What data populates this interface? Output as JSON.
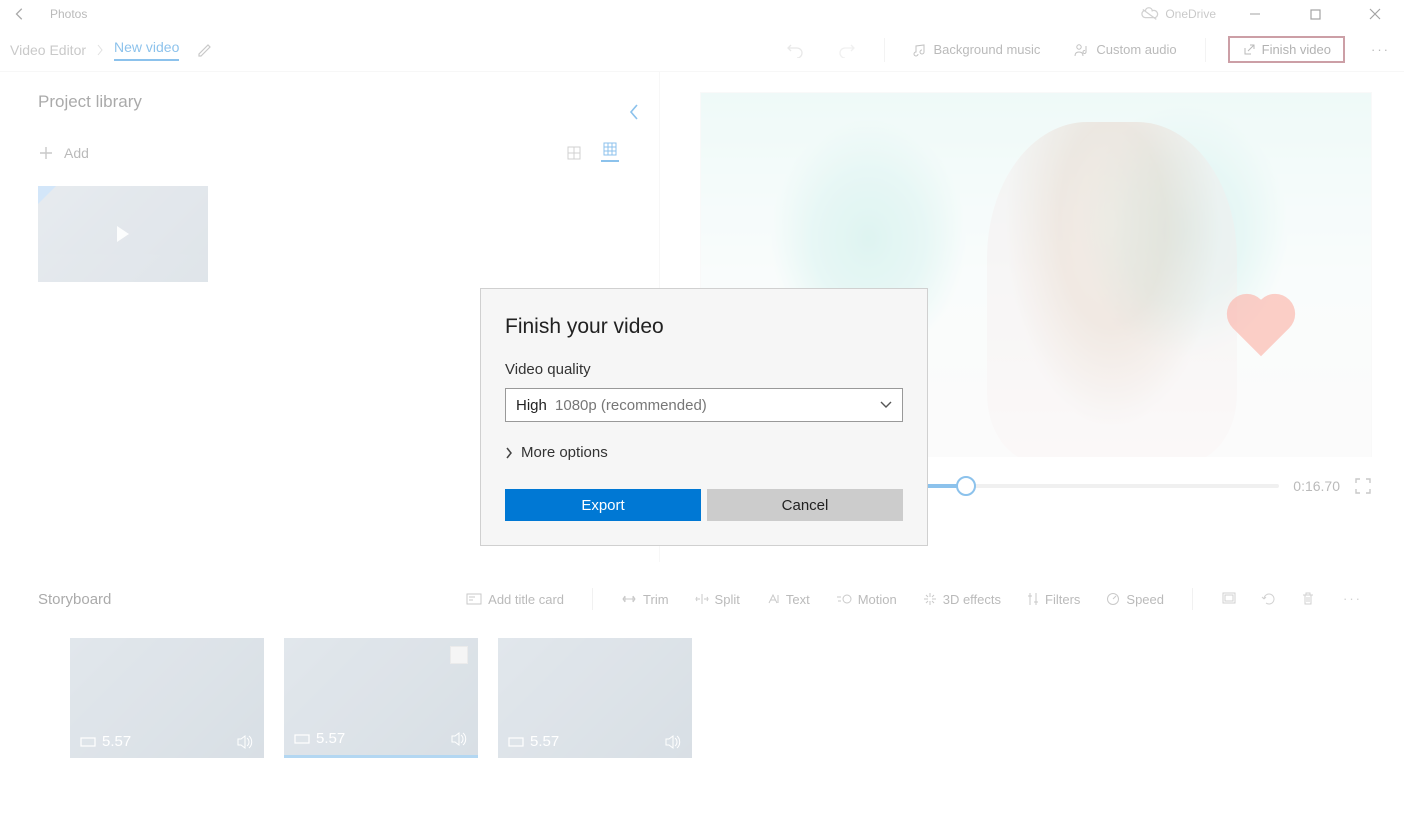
{
  "title_bar": {
    "app_name": "Photos",
    "onedrive": "OneDrive"
  },
  "breadcrumb": {
    "root": "Video Editor",
    "current": "New video"
  },
  "toolbar": {
    "bg_music": "Background music",
    "custom_audio": "Custom audio",
    "finish_video": "Finish video"
  },
  "library": {
    "title": "Project library",
    "add": "Add"
  },
  "preview": {
    "time": "0:16.70"
  },
  "storyboard": {
    "title": "Storyboard",
    "add_title_card": "Add title card",
    "trim": "Trim",
    "split": "Split",
    "text": "Text",
    "motion": "Motion",
    "effects3d": "3D effects",
    "filters": "Filters",
    "speed": "Speed",
    "clips": [
      {
        "duration": "5.57"
      },
      {
        "duration": "5.57"
      },
      {
        "duration": "5.57"
      }
    ]
  },
  "modal": {
    "title": "Finish your video",
    "quality_label": "Video quality",
    "quality_value": "High",
    "quality_detail": "1080p (recommended)",
    "more_options": "More options",
    "export": "Export",
    "cancel": "Cancel"
  }
}
